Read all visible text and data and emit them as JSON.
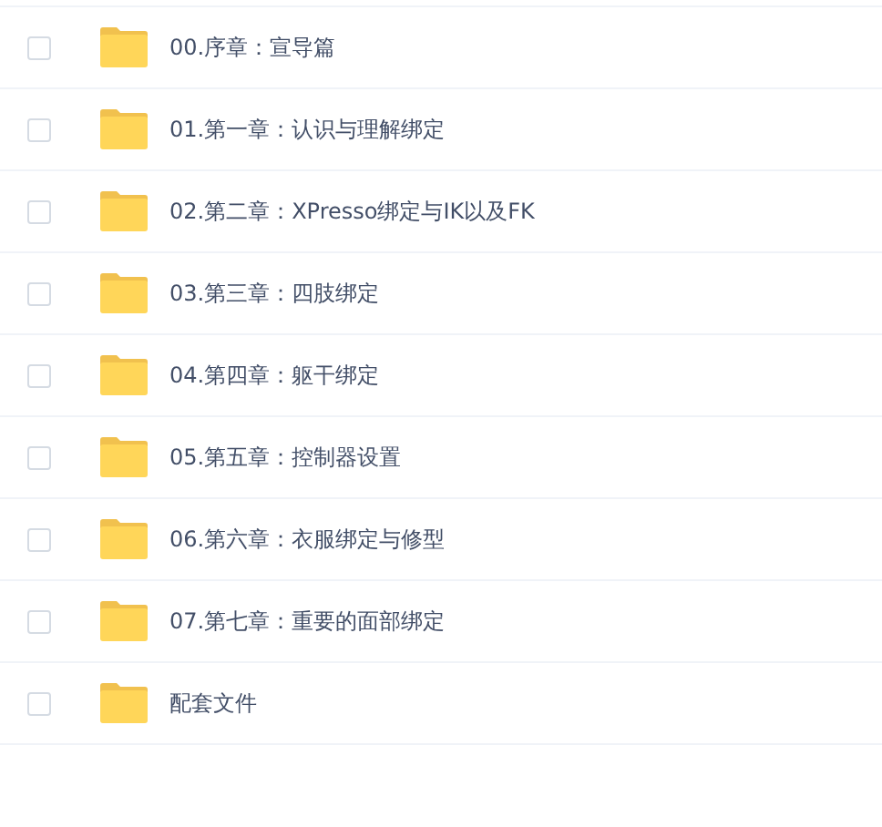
{
  "files": [
    {
      "name": "00.序章：宣导篇",
      "checked": false
    },
    {
      "name": "01.第一章：认识与理解绑定",
      "checked": false
    },
    {
      "name": "02.第二章：XPresso绑定与IK以及FK",
      "checked": false
    },
    {
      "name": "03.第三章：四肢绑定",
      "checked": false
    },
    {
      "name": "04.第四章：躯干绑定",
      "checked": false
    },
    {
      "name": "05.第五章：控制器设置",
      "checked": false
    },
    {
      "name": "06.第六章：衣服绑定与修型",
      "checked": false
    },
    {
      "name": "07.第七章：重要的面部绑定",
      "checked": false
    },
    {
      "name": "配套文件",
      "checked": false
    }
  ]
}
